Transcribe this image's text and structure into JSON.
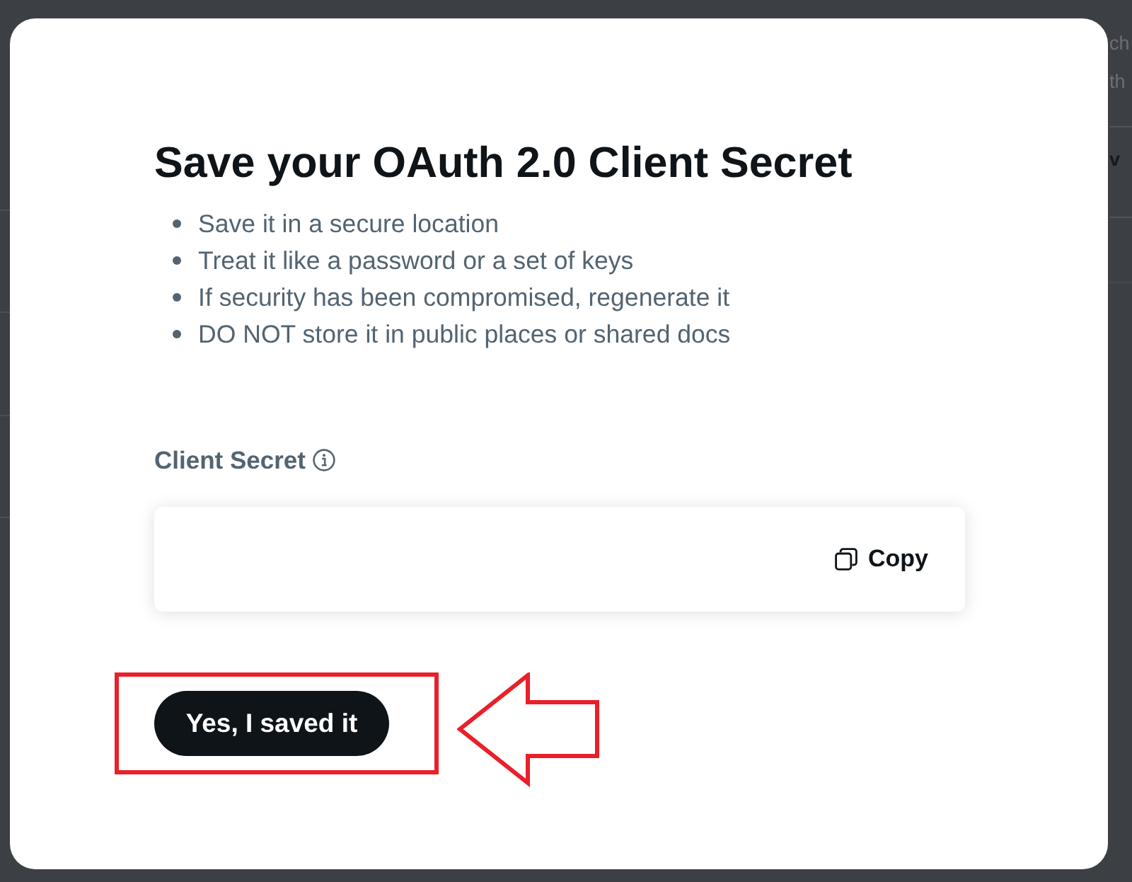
{
  "background": {
    "fragments": [
      {
        "text": "ch",
        "bold": false
      },
      {
        "text": "th",
        "bold": false
      },
      {
        "text": "v",
        "bold": true
      }
    ]
  },
  "dialog": {
    "title": "Save your OAuth 2.0 Client Secret",
    "tips": [
      "Save it in a secure location",
      "Treat it like a password or a set of keys",
      "If security has been compromised, regenerate it",
      "DO NOT store it in public places or shared docs"
    ],
    "secret_field": {
      "label": "Client Secret",
      "copy_button": "Copy"
    },
    "confirm_button": "Yes, I saved it"
  }
}
